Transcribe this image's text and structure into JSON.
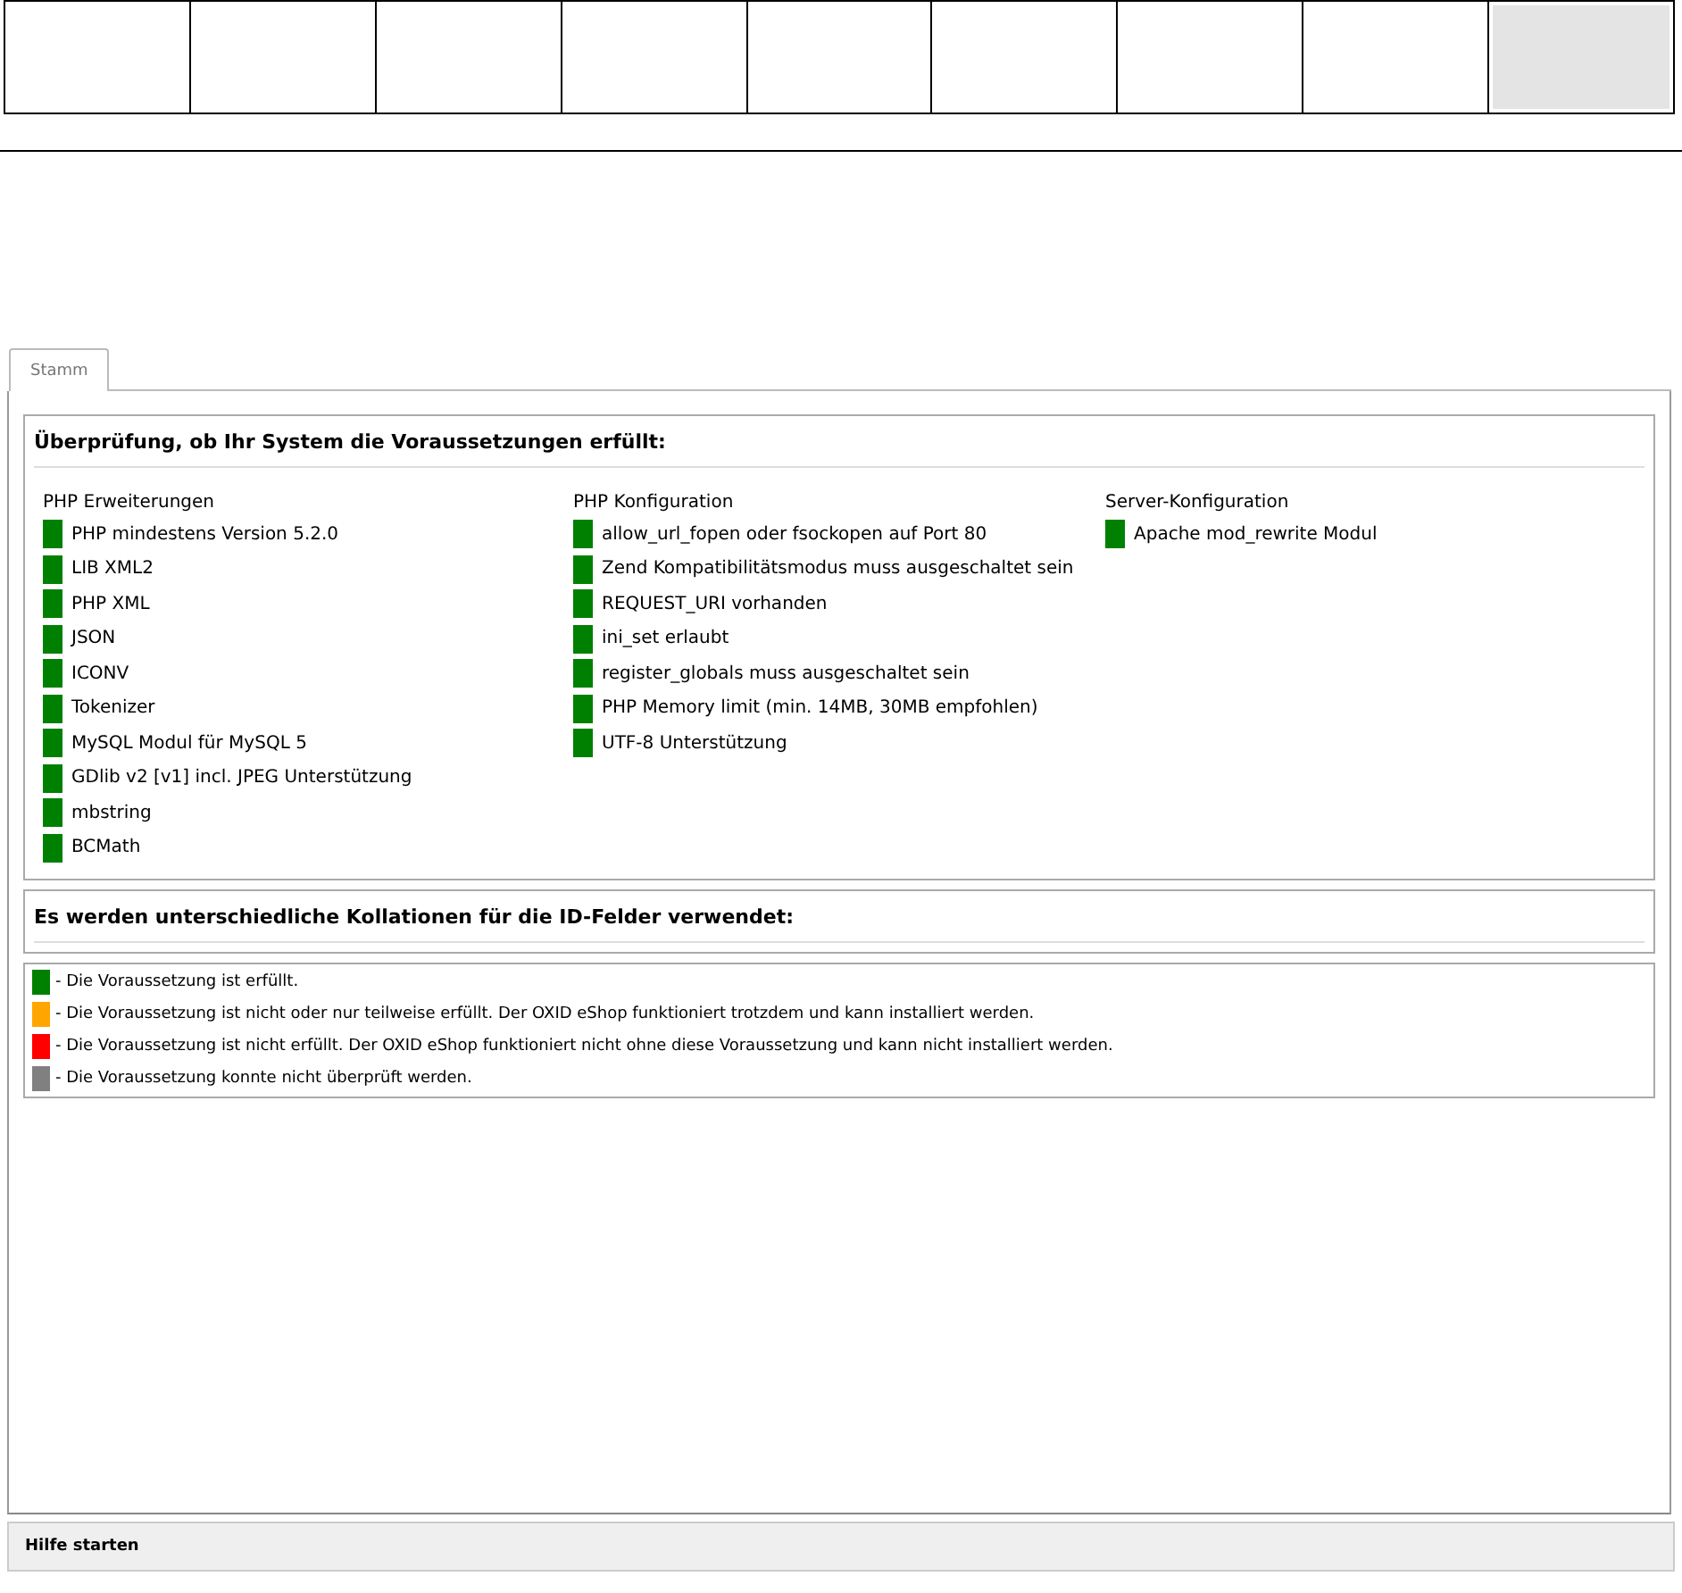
{
  "top_cells": [
    {
      "selected": false
    },
    {
      "selected": false
    },
    {
      "selected": false
    },
    {
      "selected": false
    },
    {
      "selected": false
    },
    {
      "selected": false
    },
    {
      "selected": false
    },
    {
      "selected": false
    },
    {
      "selected": true
    }
  ],
  "tabs": [
    {
      "label": "Stamm",
      "selected": true
    }
  ],
  "check_section": {
    "title": "Überprüfung, ob Ihr System die Voraussetzungen erfüllt:",
    "groups": [
      {
        "title": "PHP Erweiterungen",
        "items": [
          {
            "label": "PHP mindestens Version 5.2.0",
            "color": "#008000"
          },
          {
            "label": "LIB XML2",
            "color": "#008000"
          },
          {
            "label": "PHP XML",
            "color": "#008000"
          },
          {
            "label": "JSON",
            "color": "#008000"
          },
          {
            "label": "ICONV",
            "color": "#008000"
          },
          {
            "label": "Tokenizer",
            "color": "#008000"
          },
          {
            "label": "MySQL Modul für MySQL 5",
            "color": "#008000"
          },
          {
            "label": "GDlib v2 [v1] incl. JPEG Unterstützung",
            "color": "#008000"
          },
          {
            "label": "mbstring",
            "color": "#008000"
          },
          {
            "label": "BCMath",
            "color": "#008000"
          }
        ]
      },
      {
        "title": "PHP Konfiguration",
        "items": [
          {
            "label": "allow_url_fopen oder fsockopen auf Port 80",
            "color": "#008000"
          },
          {
            "label": "Zend Kompatibilitätsmodus muss ausgeschaltet sein",
            "color": "#008000"
          },
          {
            "label": "REQUEST_URI vorhanden",
            "color": "#008000"
          },
          {
            "label": "ini_set erlaubt",
            "color": "#008000"
          },
          {
            "label": "register_globals muss ausgeschaltet sein",
            "color": "#008000"
          },
          {
            "label": "PHP Memory limit (min. 14MB, 30MB empfohlen)",
            "color": "#008000"
          },
          {
            "label": "UTF-8 Unterstützung",
            "color": "#008000"
          }
        ]
      },
      {
        "title": "Server-Konfiguration",
        "items": [
          {
            "label": "Apache mod_rewrite Modul",
            "color": "#008000"
          }
        ]
      }
    ]
  },
  "collation_section": {
    "title": "Es werden unterschiedliche Kollationen für die ID-Felder verwendet:"
  },
  "legend": [
    {
      "text": "- Die Voraussetzung ist erfüllt.",
      "color": "#008000"
    },
    {
      "text": "- Die Voraussetzung ist nicht oder nur teilweise erfüllt. Der OXID eShop funktioniert trotzdem und kann installiert werden.",
      "color": "#ffa500"
    },
    {
      "text": "- Die Voraussetzung ist nicht erfüllt. Der OXID eShop funktioniert nicht ohne diese Voraussetzung und kann nicht installiert werden.",
      "color": "#ff0000"
    },
    {
      "text": "- Die Voraussetzung konnte nicht überprüft werden.",
      "color": "#808080"
    }
  ],
  "help_bar": {
    "label": "Hilfe starten"
  }
}
